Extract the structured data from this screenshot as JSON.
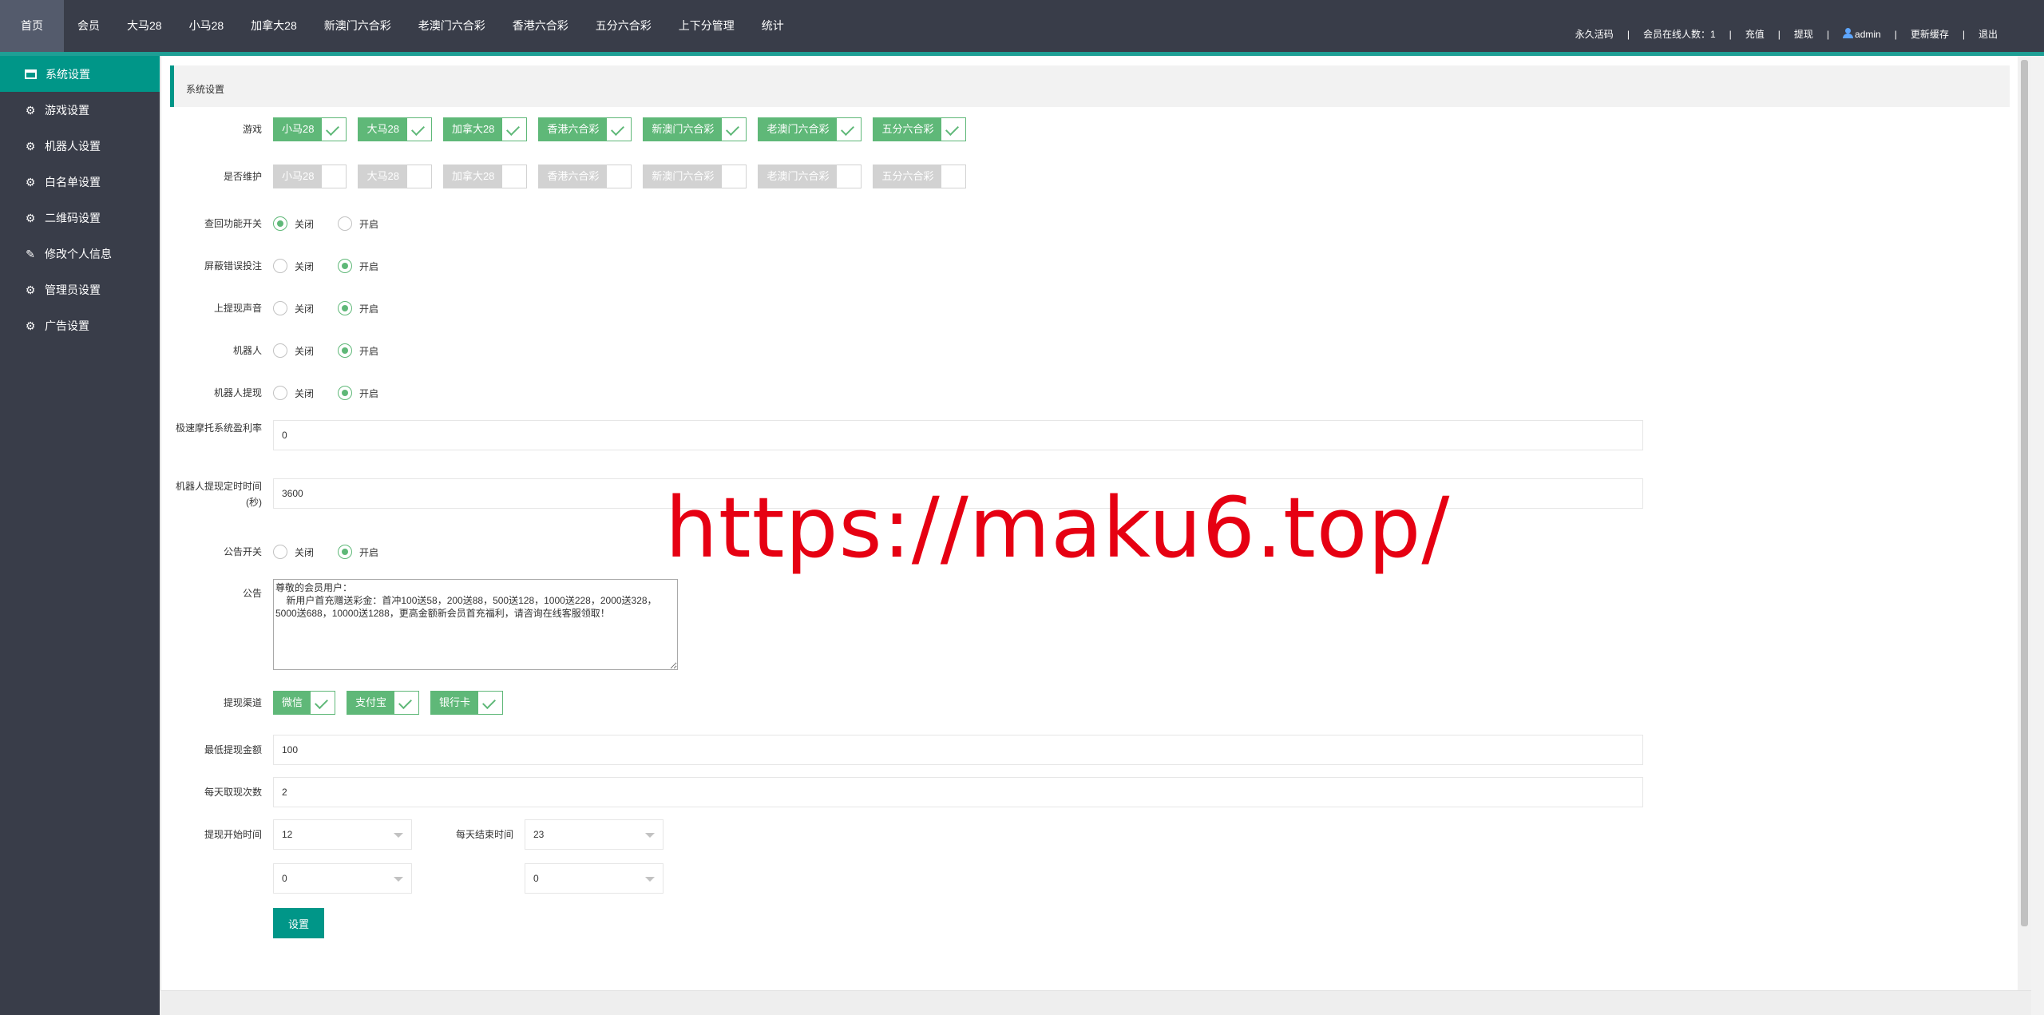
{
  "topnav": {
    "items": [
      "首页",
      "会员",
      "大马28",
      "小马28",
      "加拿大28",
      "新澳门六合彩",
      "老澳门六合彩",
      "香港六合彩",
      "五分六合彩",
      "上下分管理",
      "统计"
    ],
    "right": {
      "activate": "永久活码",
      "online": "会员在线人数：1",
      "recharge": "充值",
      "withdraw": "提现",
      "user": "admin",
      "cache": "更新缓存",
      "logout": "退出"
    }
  },
  "sidebar": {
    "items": [
      {
        "label": "系统设置",
        "icon": "window-icon"
      },
      {
        "label": "游戏设置",
        "icon": "gear-icon"
      },
      {
        "label": "机器人设置",
        "icon": "gear-icon"
      },
      {
        "label": "白名单设置",
        "icon": "gear-icon"
      },
      {
        "label": "二维码设置",
        "icon": "gear-icon"
      },
      {
        "label": "修改个人信息",
        "icon": "pencil-icon"
      },
      {
        "label": "管理员设置",
        "icon": "gear-icon"
      },
      {
        "label": "广告设置",
        "icon": "gear-icon"
      }
    ]
  },
  "page": {
    "title": "系统设置",
    "games_label": "游戏",
    "games": [
      "小马28",
      "大马28",
      "加拿大28",
      "香港六合彩",
      "新澳门六合彩",
      "老澳门六合彩",
      "五分六合彩"
    ],
    "maintenance_label": "是否维护",
    "maintenance": [
      "小马28",
      "大马28",
      "加拿大28",
      "香港六合彩",
      "新澳门六合彩",
      "老澳门六合彩",
      "五分六合彩"
    ],
    "off_label": "关闭",
    "on_label": "开启",
    "switches": [
      {
        "label": "查回功能开关",
        "value": "关闭"
      },
      {
        "label": "屏蔽错误投注",
        "value": "开启"
      },
      {
        "label": "上提现声音",
        "value": "开启"
      },
      {
        "label": "机器人",
        "value": "开启"
      },
      {
        "label": "机器人提现",
        "value": "开启"
      }
    ],
    "profit_rate_label": "极速摩托系统盈利率",
    "profit_rate": "0",
    "robot_interval_label": "机器人提现定时时间(秒)",
    "robot_interval": "3600",
    "notice_switch_label": "公告开关",
    "notice_switch": "开启",
    "notice_label": "公告",
    "notice_text": "尊敬的会员用户：\n    新用户首充赠送彩金：首冲100送58，200送88，500送128，1000送228，2000送328，5000送688，10000送1288，更高金额新会员首充福利，请咨询在线客服领取！",
    "channels_label": "提现渠道",
    "channels": [
      "微信",
      "支付宝",
      "银行卡"
    ],
    "min_withdraw_label": "最低提现金额",
    "min_withdraw": "100",
    "daily_times_label": "每天取现次数",
    "daily_times": "2",
    "start_time_label": "提现开始时间",
    "start_hour": "12",
    "start_minute": "0",
    "end_time_label": "每天结束时间",
    "end_hour": "23",
    "end_minute": "0",
    "submit_label": "设置"
  },
  "watermark": "https://maku6.top/",
  "colors": {
    "accent": "#009688",
    "check_green": "#5fb878",
    "nav_bg": "#393d49",
    "watermark": "#e60012"
  }
}
